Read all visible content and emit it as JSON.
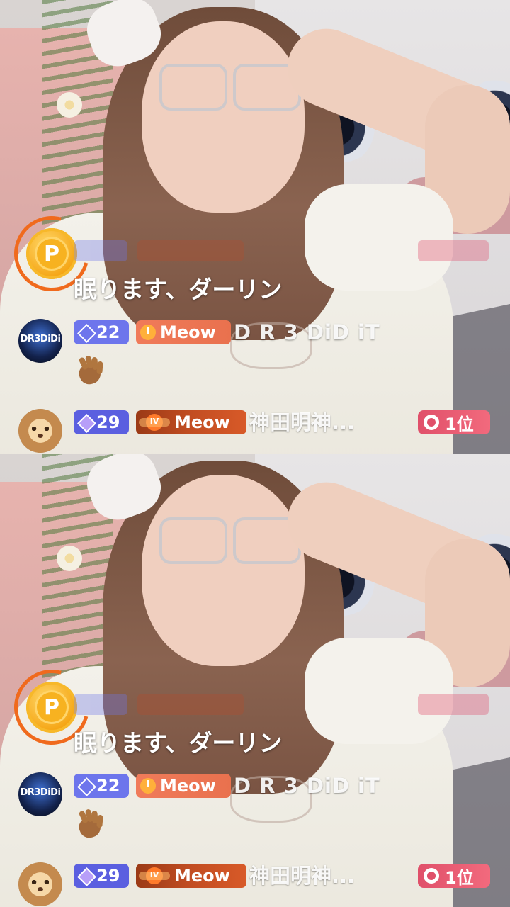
{
  "panels": [
    {
      "id": "top",
      "coin_icon": "p-coin-icon",
      "coin_letter": "P",
      "message": "眠ります、ダーリン",
      "comments": [
        {
          "avatar_icon": "dj-avatar",
          "avatar_text": "DR3DiDi",
          "level": "22",
          "fan_level": "I",
          "fan_club": "Meow",
          "username": "D R 3 DiD iT",
          "emoji": "waving-hand-icon"
        },
        {
          "avatar_icon": "lion-avatar",
          "level": "29",
          "fan_level": "IV",
          "fan_club": "Meow",
          "username": "神田明神...",
          "rank": "1位"
        }
      ]
    },
    {
      "id": "bottom",
      "coin_icon": "p-coin-icon",
      "coin_letter": "P",
      "message": "眠ります、ダーリン",
      "comments": [
        {
          "avatar_icon": "dj-avatar",
          "avatar_text": "DR3DiDi",
          "level": "22",
          "fan_level": "I",
          "fan_club": "Meow",
          "username": "D R 3 DiD iT",
          "emoji": "waving-hand-icon"
        },
        {
          "avatar_icon": "lion-avatar",
          "level": "29",
          "fan_level": "IV",
          "fan_club": "Meow",
          "username": "神田明神...",
          "rank": "1位"
        }
      ]
    }
  ],
  "colors": {
    "level_badge": "#6d75ec",
    "fan_badge_1": "#f07b5a",
    "fan_badge_4": "#c24d22",
    "rank_badge": "#e0506a",
    "coin_ring": "#f06a1d"
  }
}
